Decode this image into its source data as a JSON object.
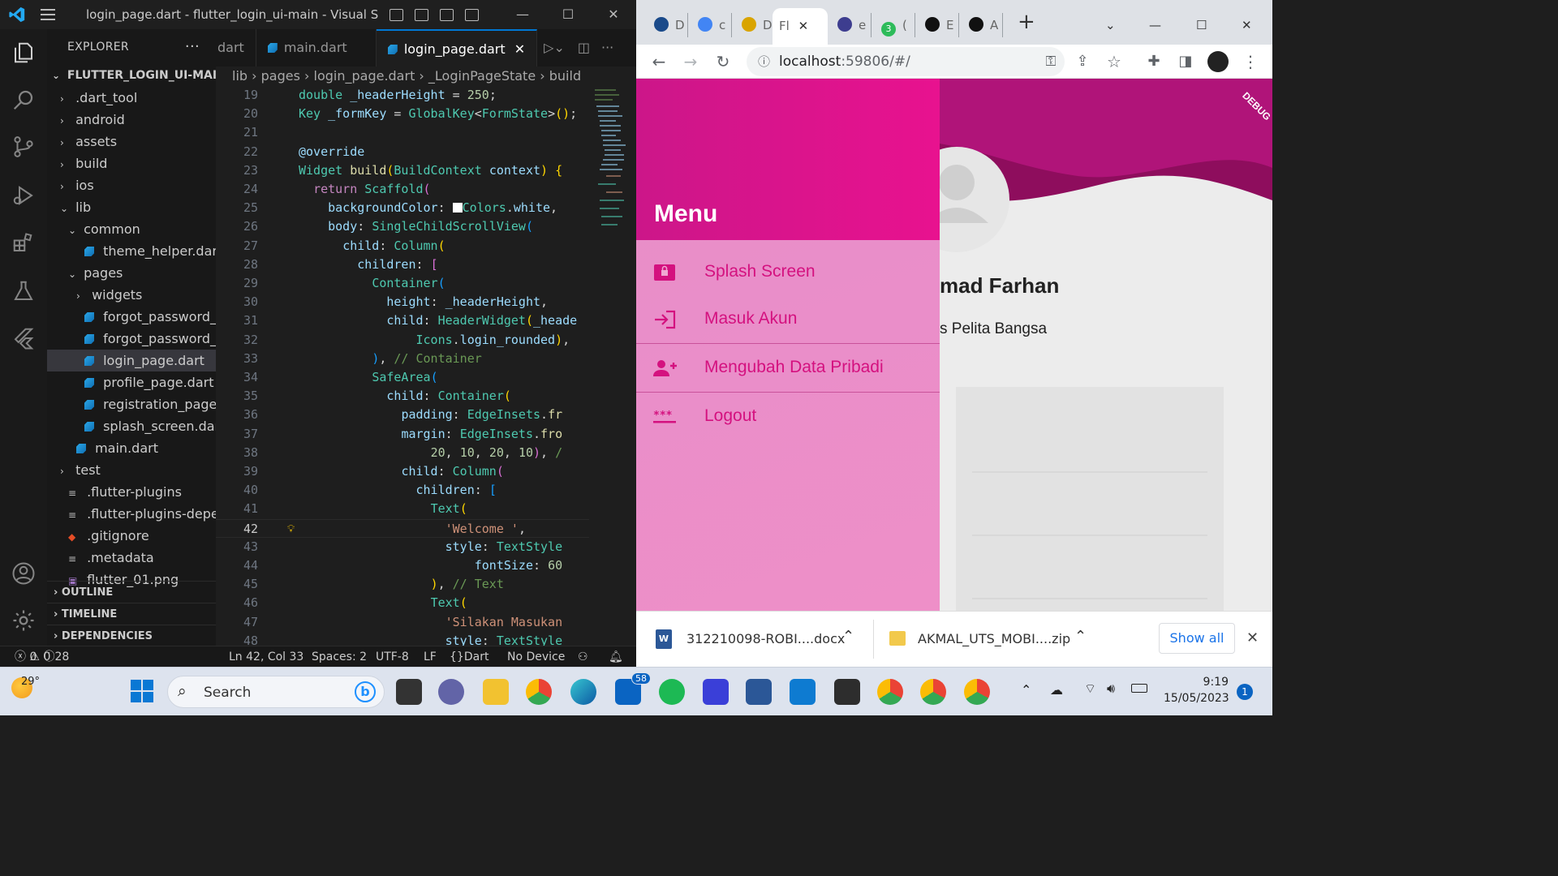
{
  "vscode": {
    "window_title": "login_page.dart - flutter_login_ui-main - Visual Studi...",
    "explorer_title": "EXPLORER",
    "project_name": "FLUTTER_LOGIN_UI-MAIN",
    "tree": [
      {
        "label": ".dart_tool",
        "type": "folder",
        "depth": 1,
        "open": false
      },
      {
        "label": "android",
        "type": "folder",
        "depth": 1,
        "open": false
      },
      {
        "label": "assets",
        "type": "folder",
        "depth": 1,
        "open": false
      },
      {
        "label": "build",
        "type": "folder",
        "depth": 1,
        "open": false
      },
      {
        "label": "ios",
        "type": "folder",
        "depth": 1,
        "open": false
      },
      {
        "label": "lib",
        "type": "folder",
        "depth": 1,
        "open": true
      },
      {
        "label": "common",
        "type": "folder",
        "depth": 2,
        "open": true
      },
      {
        "label": "theme_helper.dart",
        "type": "dart",
        "depth": 3
      },
      {
        "label": "pages",
        "type": "folder",
        "depth": 2,
        "open": true
      },
      {
        "label": "widgets",
        "type": "folder",
        "depth": 3,
        "open": false
      },
      {
        "label": "forgot_password_p...",
        "type": "dart",
        "depth": 3
      },
      {
        "label": "forgot_password_v...",
        "type": "dart",
        "depth": 3
      },
      {
        "label": "login_page.dart",
        "type": "dart",
        "depth": 3,
        "selected": true
      },
      {
        "label": "profile_page.dart",
        "type": "dart",
        "depth": 3
      },
      {
        "label": "registration_page....",
        "type": "dart",
        "depth": 3
      },
      {
        "label": "splash_screen.dart",
        "type": "dart",
        "depth": 3
      },
      {
        "label": "main.dart",
        "type": "dart",
        "depth": 2
      },
      {
        "label": "test",
        "type": "folder",
        "depth": 1,
        "open": false
      },
      {
        "label": ".flutter-plugins",
        "type": "lines",
        "depth": 1
      },
      {
        "label": ".flutter-plugins-depe...",
        "type": "lines",
        "depth": 1
      },
      {
        "label": ".gitignore",
        "type": "git",
        "depth": 1
      },
      {
        "label": ".metadata",
        "type": "lines",
        "depth": 1
      },
      {
        "label": "flutter_01.png",
        "type": "img",
        "depth": 1
      }
    ],
    "sections": [
      "OUTLINE",
      "TIMELINE",
      "DEPENDENCIES"
    ],
    "tabs": [
      "dart",
      "main.dart",
      "login_page.dart"
    ],
    "breadcrumb": [
      "lib",
      "pages",
      "login_page.dart",
      "_LoginPageState",
      "build"
    ],
    "code_lines": [
      {
        "n": "19",
        "html": "<span class='t'>double</span> <span class='v'>_headerHeight</span> <span class='p'>=</span> <span class='n'>250</span><span class='p'>;</span>",
        "indent": 0
      },
      {
        "n": "20",
        "html": "<span class='t'>Key</span> <span class='v'>_formKey</span> <span class='p'>=</span> <span class='t'>GlobalKey</span><span class='p'>&lt;</span><span class='t'>FormState</span><span class='p'>&gt;</span><span class='y'>()</span><span class='p'>;</span>",
        "indent": 0
      },
      {
        "n": "21",
        "html": "",
        "indent": 0
      },
      {
        "n": "22",
        "html": "<span class='v'>@override</span>",
        "indent": 0
      },
      {
        "n": "23",
        "html": "<span class='t'>Widget</span> <span class='f'>build</span><span class='y'>(</span><span class='t'>BuildContext</span> <span class='v'>context</span><span class='y'>)</span> <span class='y'>{</span>",
        "indent": 0
      },
      {
        "n": "24",
        "html": "  <span class='k'>return</span> <span class='t'>Scaffold</span><span class='m'>(</span>",
        "indent": 0
      },
      {
        "n": "25",
        "html": "    <span class='v'>backgroundColor</span><span class='p'>:</span> <span style='display:inline-block;width:12px;height:12px;background:#fff;vertical-align:-1px'></span><span class='t'>Colors</span><span class='p'>.</span><span class='v'>white</span><span class='p'>,</span>",
        "indent": 0
      },
      {
        "n": "26",
        "html": "    <span class='v'>body</span><span class='p'>:</span> <span class='t'>SingleChildScrollView</span><span class='b'>(</span>",
        "indent": 0
      },
      {
        "n": "27",
        "html": "      <span class='v'>child</span><span class='p'>:</span> <span class='t'>Column</span><span class='y'>(</span>",
        "indent": 0
      },
      {
        "n": "28",
        "html": "        <span class='v'>children</span><span class='p'>:</span> <span class='m'>[</span>",
        "indent": 0
      },
      {
        "n": "29",
        "html": "          <span class='t'>Container</span><span class='b'>(</span>",
        "indent": 0
      },
      {
        "n": "30",
        "html": "            <span class='v'>height</span><span class='p'>:</span> <span class='v'>_headerHeight</span><span class='p'>,</span>",
        "indent": 0
      },
      {
        "n": "31",
        "html": "            <span class='v'>child</span><span class='p'>:</span> <span class='t'>HeaderWidget</span><span class='y'>(</span><span class='v'>_heade</span>",
        "indent": 0
      },
      {
        "n": "32",
        "html": "                <span class='t'>Icons</span><span class='p'>.</span><span class='v'>login_rounded</span><span class='y'>)</span><span class='p'>,</span>",
        "indent": 0
      },
      {
        "n": "33",
        "html": "          <span class='b'>)</span><span class='p'>,</span> <span class='c'>// Container</span>",
        "indent": 0
      },
      {
        "n": "34",
        "html": "          <span class='t'>SafeArea</span><span class='b'>(</span>",
        "indent": 0
      },
      {
        "n": "35",
        "html": "            <span class='v'>child</span><span class='p'>:</span> <span class='t'>Container</span><span class='y'>(</span>",
        "indent": 0
      },
      {
        "n": "36",
        "html": "              <span class='v'>padding</span><span class='p'>:</span> <span class='t'>EdgeInsets</span><span class='p'>.</span><span class='f'>fr</span>",
        "indent": 0
      },
      {
        "n": "37",
        "html": "              <span class='v'>margin</span><span class='p'>:</span> <span class='t'>EdgeInsets</span><span class='p'>.</span><span class='f'>fro</span>",
        "indent": 0
      },
      {
        "n": "38",
        "html": "                  <span class='n'>20</span><span class='p'>,</span> <span class='n'>10</span><span class='p'>,</span> <span class='n'>20</span><span class='p'>,</span> <span class='n'>10</span><span class='m'>)</span><span class='p'>,</span> <span class='c'>/</span>",
        "indent": 0
      },
      {
        "n": "39",
        "html": "              <span class='v'>child</span><span class='p'>:</span> <span class='t'>Column</span><span class='m'>(</span>",
        "indent": 0
      },
      {
        "n": "40",
        "html": "                <span class='v'>children</span><span class='p'>:</span> <span class='b'>[</span>",
        "indent": 0
      },
      {
        "n": "41",
        "html": "                  <span class='t'>Text</span><span class='y'>(</span>",
        "indent": 0
      },
      {
        "n": "42",
        "html": "                    <span class='s'>'Welcome '</span><span class='p'>,</span>",
        "indent": 0
      },
      {
        "n": "43",
        "html": "                    <span class='v'>style</span><span class='p'>:</span> <span class='t'>TextStyle</span>",
        "indent": 0
      },
      {
        "n": "44",
        "html": "                        <span class='v'>fontSize</span><span class='p'>:</span> <span class='n'>60</span>",
        "indent": 0
      },
      {
        "n": "45",
        "html": "                  <span class='y'>)</span><span class='p'>,</span> <span class='c'>// Text</span>",
        "indent": 0
      },
      {
        "n": "46",
        "html": "                  <span class='t'>Text</span><span class='y'>(</span>",
        "indent": 0
      },
      {
        "n": "47",
        "html": "                    <span class='s'>'Silakan Masukan</span>",
        "indent": 0
      },
      {
        "n": "48",
        "html": "                    <span class='v'>style</span><span class='p'>:</span> <span class='t'>TextStyle</span>",
        "indent": 0
      }
    ],
    "status": {
      "errors": "0",
      "warnings": "0",
      "info": "28",
      "position": "Ln 42, Col 33",
      "spaces": "Spaces: 2",
      "encoding": "UTF-8",
      "eol": "LF",
      "language": "Dart",
      "device": "No Device"
    }
  },
  "chrome": {
    "tabs": [
      {
        "label": "D",
        "color": "#1a4a8a"
      },
      {
        "label": "c",
        "color": "#4285f4"
      },
      {
        "label": "D",
        "color": "#d9a400"
      },
      {
        "label": "Fl",
        "color": "#ffffff",
        "active": true
      },
      {
        "label": "e",
        "color": "#3d3d8f"
      },
      {
        "label": "(",
        "color": "#2dbb5a",
        "badge": "3"
      },
      {
        "label": "E",
        "color": "#111111"
      },
      {
        "label": "A",
        "color": "#111111"
      }
    ],
    "url_host": "localhost",
    "url_path": ":59806/#/",
    "debug_label": "DEBUG",
    "drawer": {
      "title": "Menu",
      "items": [
        {
          "label": "Splash Screen",
          "icon": "screen-lock-icon"
        },
        {
          "label": "Masuk Akun",
          "icon": "login-icon"
        },
        {
          "label": "Mengubah Data Pribadi",
          "icon": "person-add-icon"
        },
        {
          "label": "Logout",
          "icon": "password-icon"
        }
      ]
    },
    "profile": {
      "name_fragment": "mad Farhan",
      "org_fragment": "s Pelita Bangsa"
    },
    "downloads": [
      {
        "name": "312210098-ROBI....docx",
        "type": "word"
      },
      {
        "name": "AKMAL_UTS_MOBI....zip",
        "type": "zip"
      }
    ],
    "show_all": "Show all"
  },
  "taskbar": {
    "weather": "29°",
    "search": "Search",
    "mail_badge": "58",
    "time": "9:19",
    "date": "15/05/2023",
    "notif_count": "1"
  },
  "colors": {
    "accent_pink": "#e8128f",
    "drawer_text": "#d4117f",
    "vscode_blue": "#0078d4"
  }
}
